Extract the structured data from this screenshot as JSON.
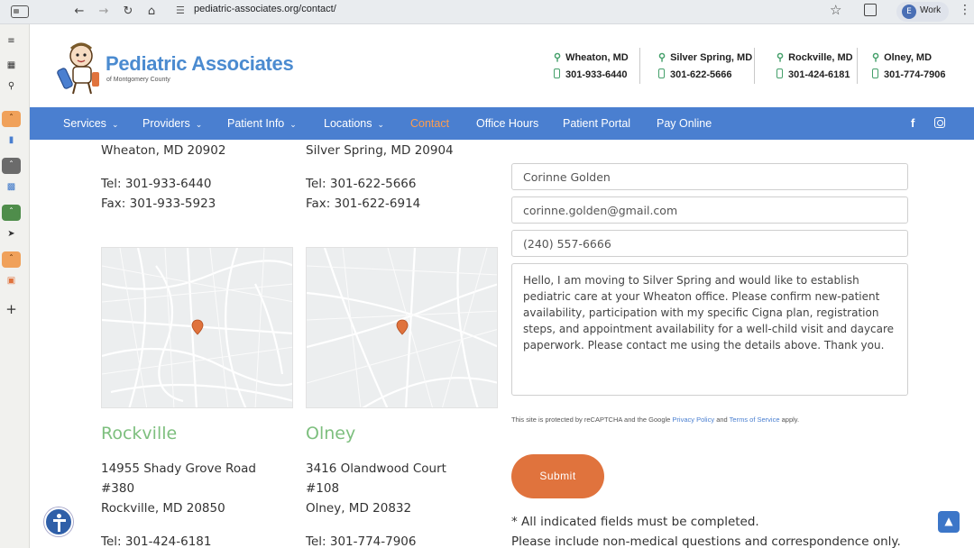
{
  "browser": {
    "url": "pediatric-associates.org/contact/",
    "profile_initial": "E",
    "profile_label": "Work"
  },
  "site": {
    "logo_name": "Pediatric Associates",
    "logo_sub": "of Montgomery County",
    "locations": [
      {
        "name": "Wheaton, MD",
        "phone": "301-933-6440"
      },
      {
        "name": "Silver Spring, MD",
        "phone": "301-622-5666"
      },
      {
        "name": "Rockville, MD",
        "phone": "301-424-6181"
      },
      {
        "name": "Olney, MD",
        "phone": "301-774-7906"
      }
    ],
    "nav": [
      {
        "label": "Services",
        "dropdown": true
      },
      {
        "label": "Providers",
        "dropdown": true
      },
      {
        "label": "Patient Info",
        "dropdown": true
      },
      {
        "label": "Locations",
        "dropdown": true
      },
      {
        "label": "Contact",
        "dropdown": false
      },
      {
        "label": "Office Hours",
        "dropdown": false
      },
      {
        "label": "Patient Portal",
        "dropdown": false
      },
      {
        "label": "Pay Online",
        "dropdown": false
      }
    ],
    "active_nav": "Contact",
    "accent_color": "#4a7fd0",
    "highlight_color": "#ff9d4d"
  },
  "offices": {
    "wheaton": {
      "city_line": "Wheaton, MD 20902",
      "tel": "Tel: 301-933-6440",
      "fax": "Fax: 301-933-5923"
    },
    "silver_spring": {
      "city_line": "Silver Spring, MD 20904",
      "tel": "Tel: 301-622-5666",
      "fax": "Fax: 301-622-6914"
    },
    "rockville": {
      "title": "Rockville",
      "street": "14955 Shady Grove Road",
      "suite": "#380",
      "city_line": "Rockville, MD 20850",
      "tel": "Tel: 301-424-6181"
    },
    "olney": {
      "title": "Olney",
      "street": "3416 Olandwood Court",
      "suite": "#108",
      "city_line": "Olney, MD 20832",
      "tel": "Tel: 301-774-7906"
    }
  },
  "form": {
    "name": "Corinne Golden",
    "email": "corinne.golden@gmail.com",
    "phone": "(240) 557-6666",
    "message": "Hello, I am moving to Silver Spring and would like to establish pediatric care at your Wheaton office. Please confirm new-patient availability, participation with my specific Cigna plan, registration steps, and appointment availability for a well-child visit and daycare paperwork. Please contact me using the details above. Thank you.",
    "captcha_pre": "This site is protected by reCAPTCHA and the Google ",
    "captcha_privacy": "Privacy Policy",
    "captcha_and": " and ",
    "captcha_terms": "Terms of Service",
    "captcha_post": " apply.",
    "submit_label": "Submit",
    "note_required": "* All indicated fields must be completed.",
    "note_nonmedical": "Please include non-medical questions and correspondence only."
  },
  "social": {
    "facebook": "f"
  }
}
